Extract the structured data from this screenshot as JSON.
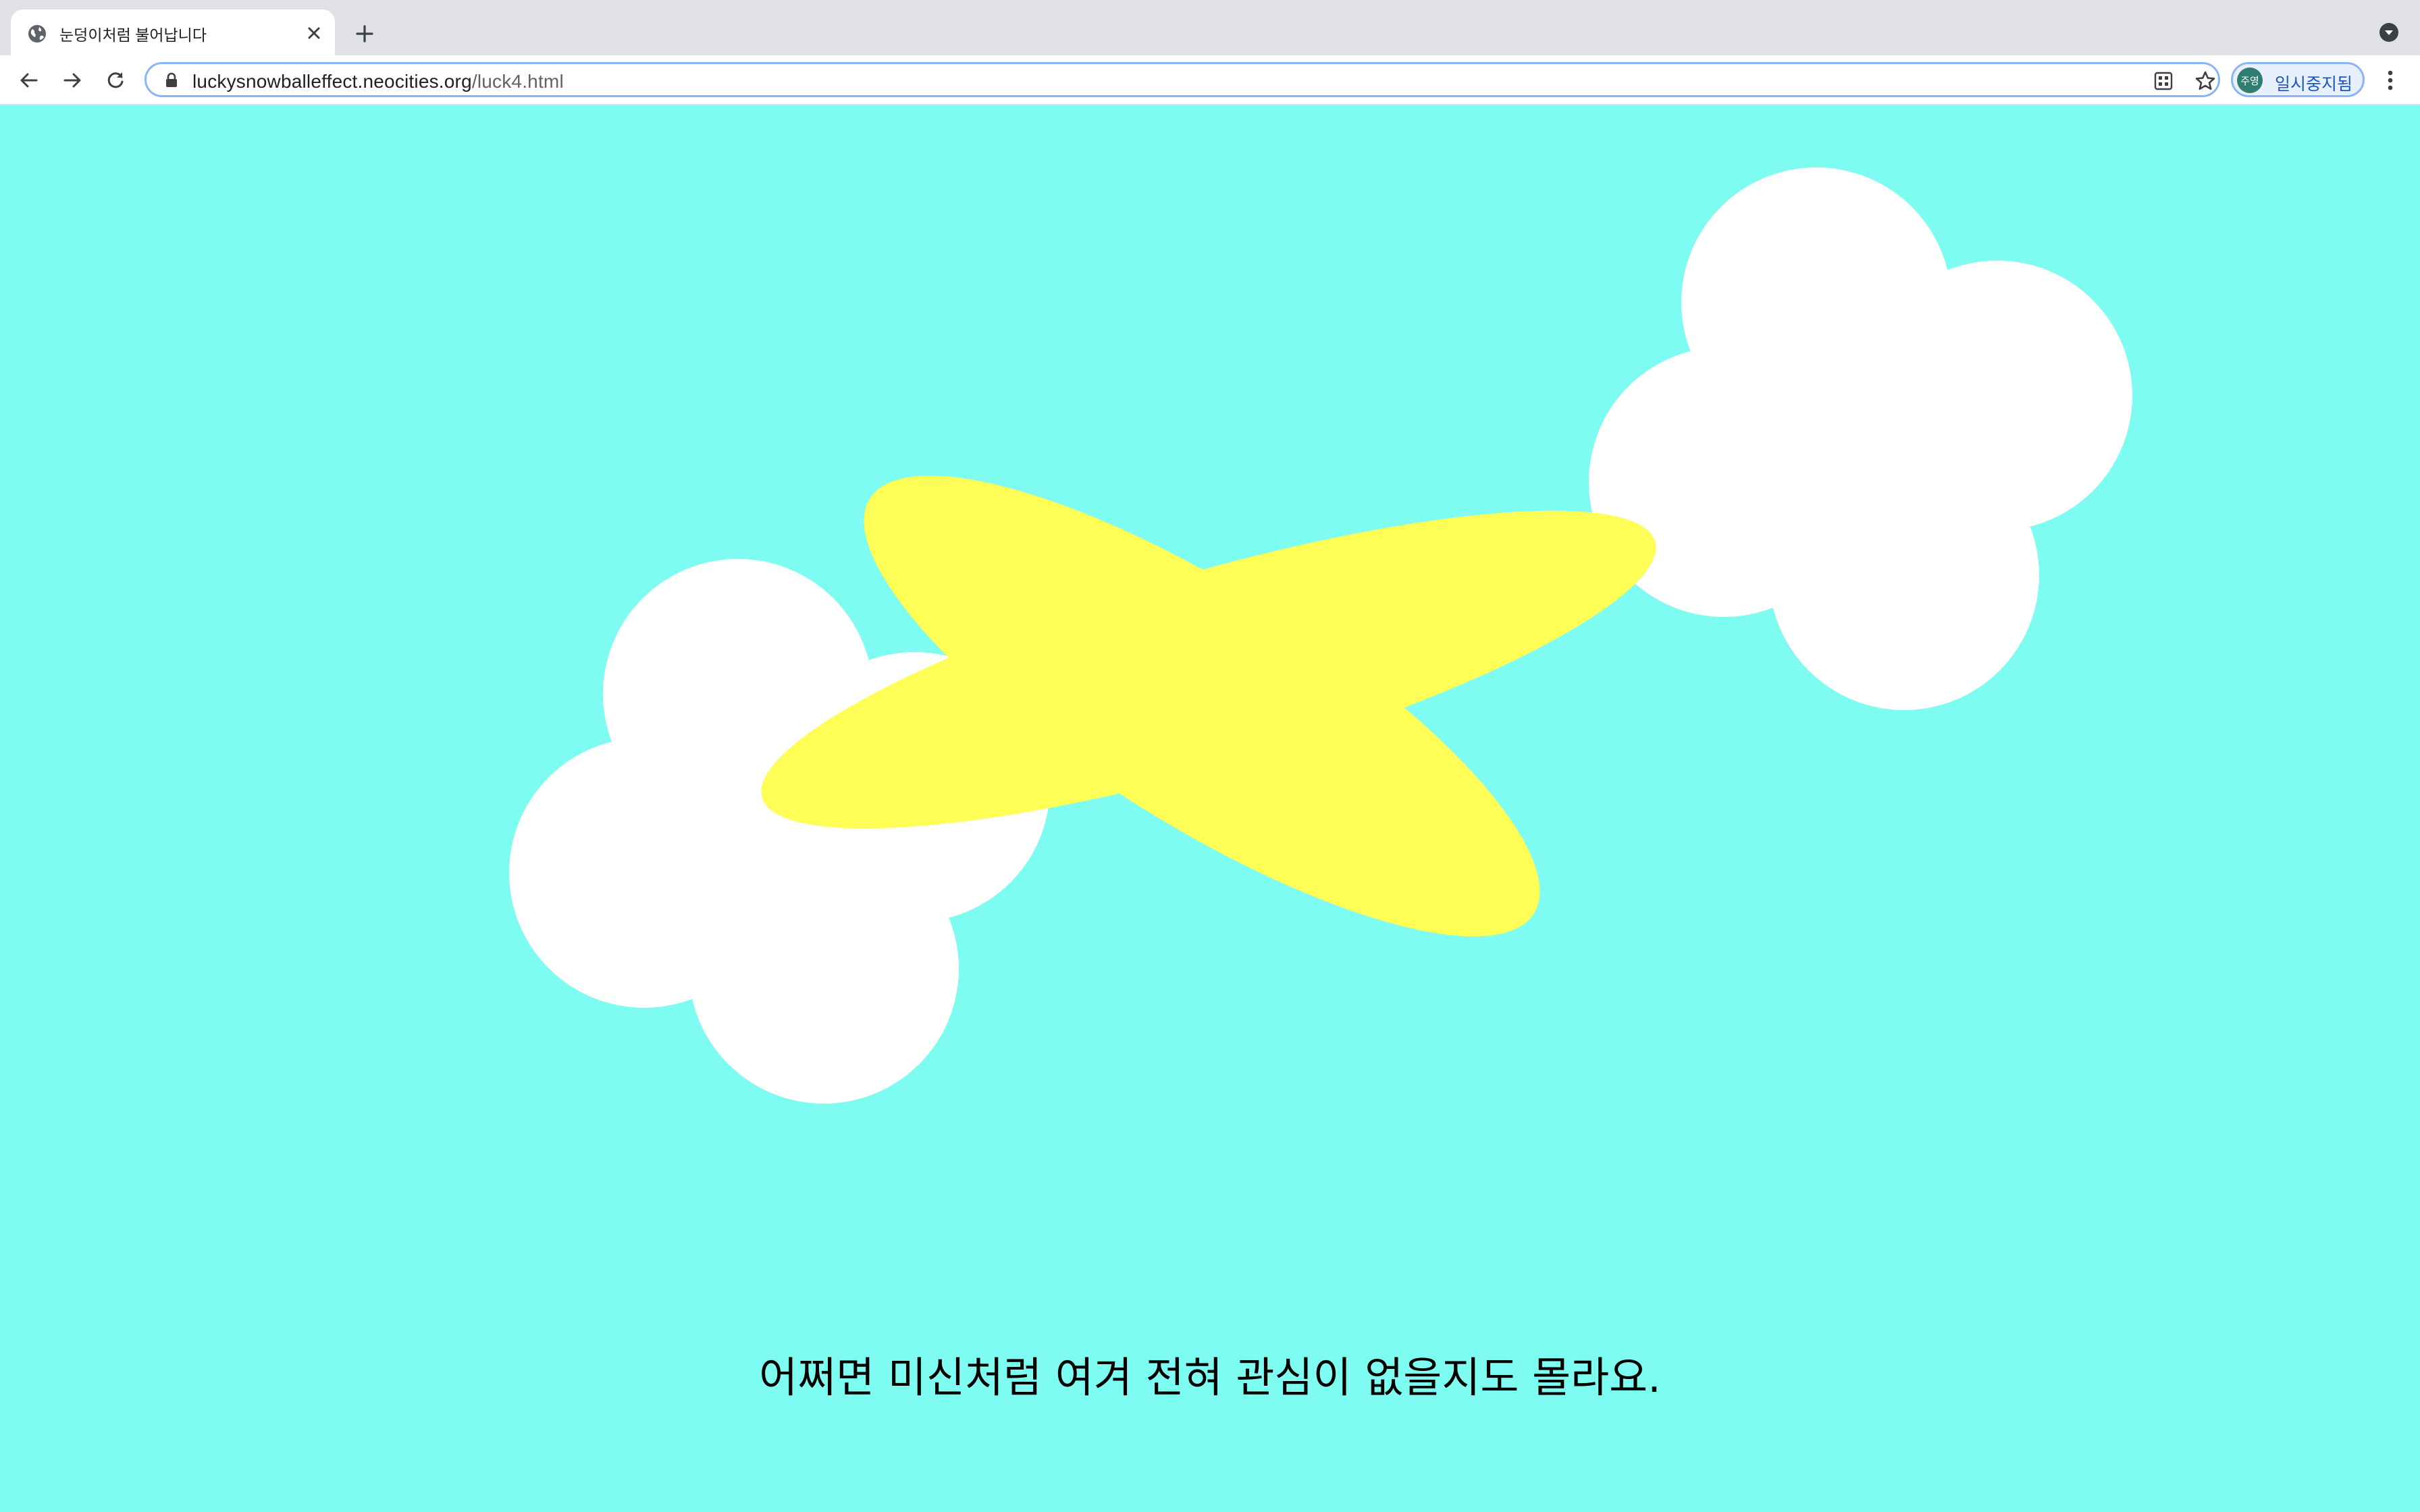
{
  "browser": {
    "tab": {
      "title": "눈덩이처럼 불어납니다",
      "favicon_icon": "globe-icon",
      "close_icon": "close-icon"
    },
    "new_tab_icon": "plus-icon",
    "tab_search_icon": "chevron-down-circle-icon",
    "toolbar": {
      "back_icon": "arrow-left-icon",
      "forward_icon": "arrow-right-icon",
      "reload_icon": "reload-icon"
    },
    "omnibox": {
      "lock_icon": "lock-icon",
      "url_host": "luckysnowballeffect.neocities.org",
      "url_path": "/luck4.html",
      "qr_icon": "qr-code-icon",
      "bookmark_icon": "star-icon"
    },
    "profile": {
      "avatar_text": "주영",
      "label": "일시중지됨"
    },
    "menu_icon": "kebab-menu-icon"
  },
  "page": {
    "background_color": "#7ffcf2",
    "cloud_color": "#ffffff",
    "airplane_color": "#fffe56",
    "caption": "어쩌면 미신처럼 여겨 전혀 관심이 없을지도 몰라요."
  }
}
